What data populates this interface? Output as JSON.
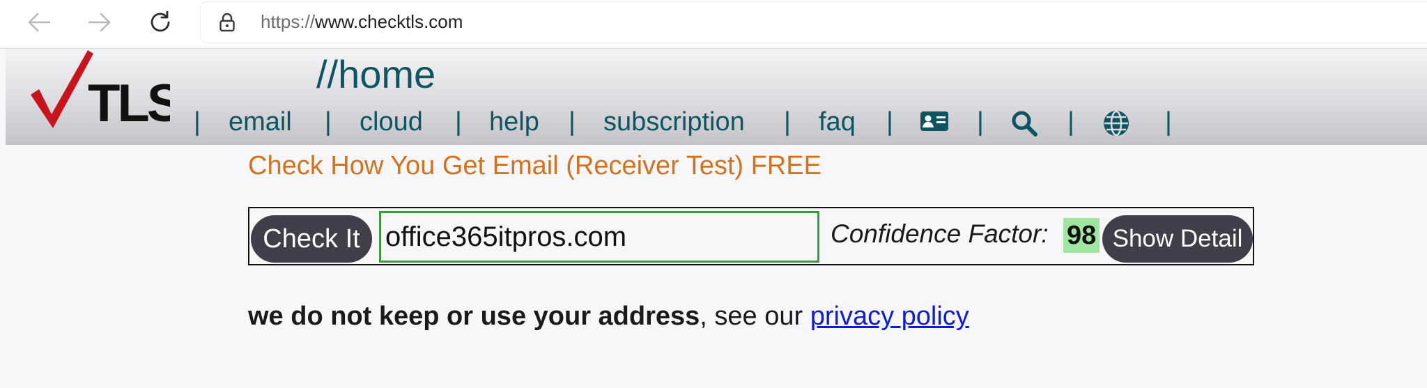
{
  "browser": {
    "url_scheme": "https://",
    "url_host": "www.checktls.com"
  },
  "site": {
    "logo_text": "TLS",
    "page_title": "//home",
    "nav": {
      "separator": "|",
      "email": "email",
      "cloud": "cloud",
      "help": "help",
      "subscription": "subscription",
      "faq": "faq",
      "icons": [
        "contact-card-icon",
        "search-icon",
        "globe-icon"
      ]
    }
  },
  "test": {
    "heading": "Check How You Get Email (Receiver Test) FREE",
    "check_button": "Check It",
    "domain_value": "office365itpros.com",
    "confidence_label": "Confidence Factor:",
    "confidence_score": "98",
    "detail_button": "Show Detail"
  },
  "privacy": {
    "bold_text": "we do not keep or use your address",
    "middle_text": ", see our ",
    "link_text": "privacy policy"
  },
  "colors": {
    "brand_teal": "#0d5560",
    "heading_orange": "#d3711d",
    "button_dark": "#3e3f4a",
    "score_highlight": "#9fe6a0",
    "input_border": "#3b9a3b",
    "link_blue": "#0d1bdc",
    "logo_red": "#c8141c"
  }
}
